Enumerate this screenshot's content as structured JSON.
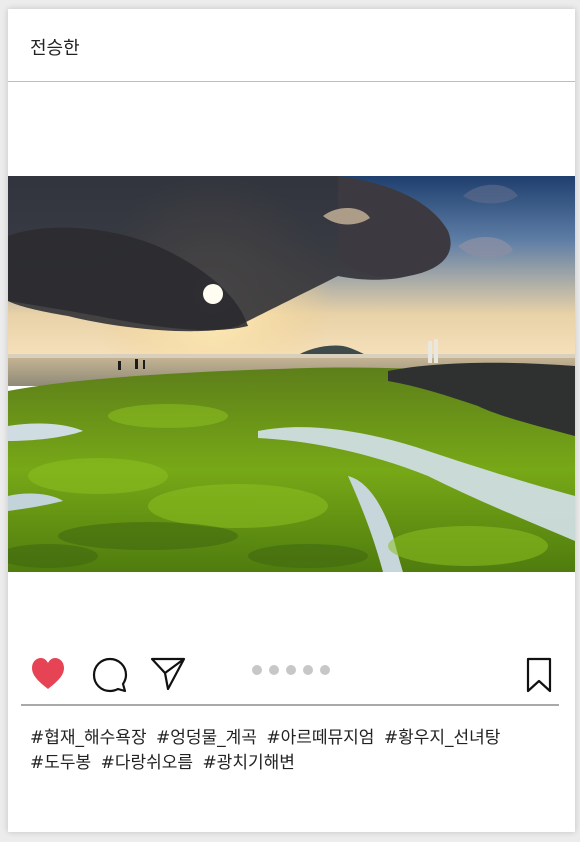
{
  "post": {
    "username": "전승한",
    "photo": {
      "alt": "",
      "colors": {
        "sky_top": "#2c4d7a",
        "sky_horizon": "#f4dcb0",
        "sun": "#fff6d8",
        "cloud": "#3a3a3e",
        "moss": "#6f9d16",
        "water": "#c9d6dc"
      }
    },
    "actions": {
      "like_icon": "heart-icon",
      "comment_icon": "speech-bubble-icon",
      "share_icon": "paper-plane-icon",
      "save_icon": "bookmark-icon",
      "liked": true,
      "like_color": "#e64455"
    },
    "carousel": {
      "count": 5,
      "active_index": 0
    },
    "hashtags": [
      "#협재_해수욕장",
      "#엉덩물_계곡",
      "#아르떼뮤지엄",
      "#황우지_선녀탕",
      "#도두봉",
      "#다랑쉬오름",
      "#광치기해변"
    ]
  }
}
